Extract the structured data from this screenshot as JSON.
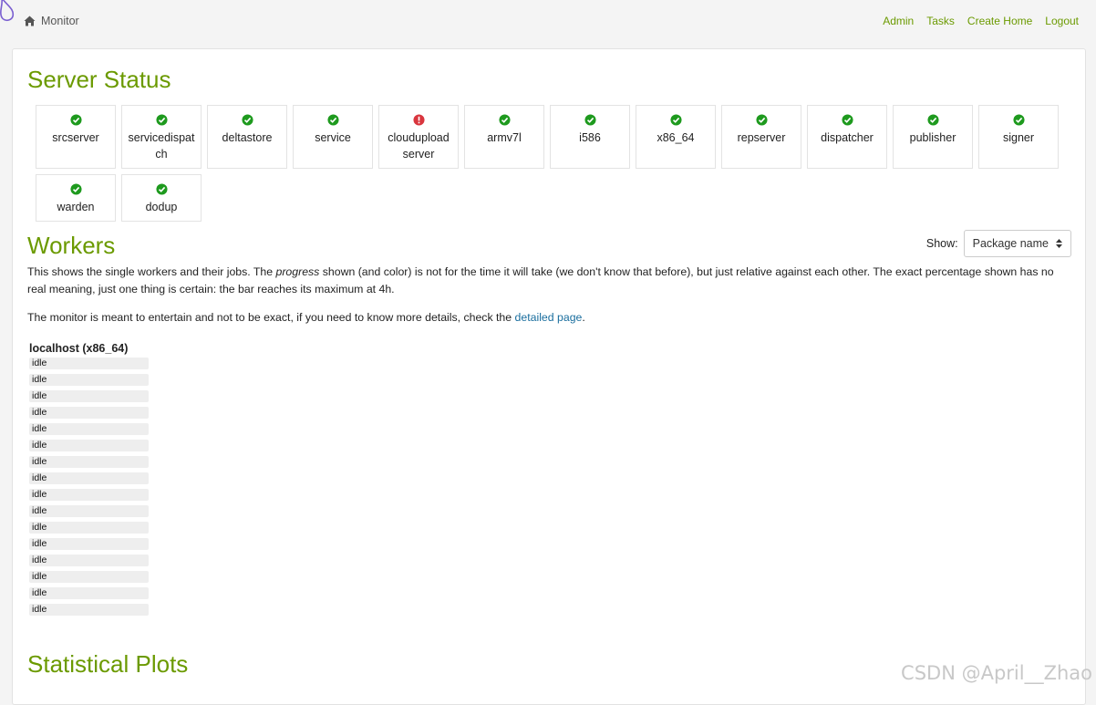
{
  "header": {
    "brand_label": "Monitor",
    "nav_links": [
      "Admin",
      "Tasks",
      "Create Home",
      "Logout"
    ]
  },
  "server_status": {
    "title": "Server Status",
    "services": [
      {
        "name": "srcserver",
        "status": "ok"
      },
      {
        "name": "servicedispatch",
        "status": "ok"
      },
      {
        "name": "deltastore",
        "status": "ok"
      },
      {
        "name": "service",
        "status": "ok"
      },
      {
        "name": "cloudupload server",
        "status": "error"
      },
      {
        "name": "armv7l",
        "status": "ok"
      },
      {
        "name": "i586",
        "status": "ok"
      },
      {
        "name": "x86_64",
        "status": "ok"
      },
      {
        "name": "repserver",
        "status": "ok"
      },
      {
        "name": "dispatcher",
        "status": "ok"
      },
      {
        "name": "publisher",
        "status": "ok"
      },
      {
        "name": "signer",
        "status": "ok"
      },
      {
        "name": "warden",
        "status": "ok"
      },
      {
        "name": "dodup",
        "status": "ok"
      }
    ]
  },
  "workers": {
    "title": "Workers",
    "show_label": "Show:",
    "show_selected": "Package name",
    "intro_part1": "This shows the single workers and their jobs. The ",
    "intro_em": "progress",
    "intro_part2": " shown (and color) is not for the time it will take (we don't know that before), but just relative against each other. The exact percentage shown has no real meaning, just one thing is certain: the bar reaches its maximum at 4h.",
    "note_part1": "The monitor is meant to entertain and not to be exact, if you need to know more details, check the ",
    "note_link": "detailed page",
    "note_part2": ".",
    "host": "localhost (x86_64)",
    "jobs": [
      "idle",
      "idle",
      "idle",
      "idle",
      "idle",
      "idle",
      "idle",
      "idle",
      "idle",
      "idle",
      "idle",
      "idle",
      "idle",
      "idle",
      "idle",
      "idle"
    ]
  },
  "stats": {
    "title": "Statistical Plots"
  },
  "watermark": "CSDN @April__Zhao",
  "colors": {
    "accent": "#6b9a00",
    "ok": "#1e9a1e",
    "error": "#d9363e",
    "link": "#1a6e9e"
  }
}
